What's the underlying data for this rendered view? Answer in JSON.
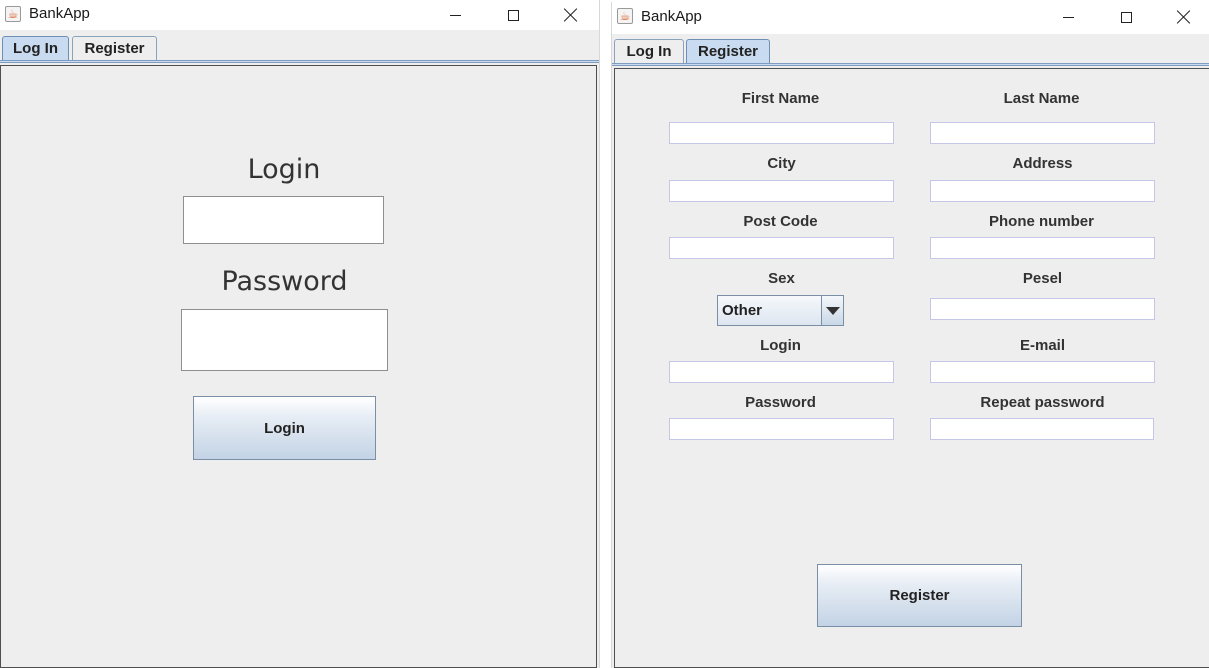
{
  "login_window": {
    "title": "BankApp",
    "tabs": [
      {
        "label": "Log In",
        "active": true
      },
      {
        "label": "Register",
        "active": false
      }
    ],
    "login_label": "Login",
    "password_label": "Password",
    "login_value": "",
    "password_value": "",
    "login_button": "Login"
  },
  "register_window": {
    "title": "BankApp",
    "tabs": [
      {
        "label": "Log In",
        "active": false
      },
      {
        "label": "Register",
        "active": true
      }
    ],
    "fields": {
      "first_name": {
        "label": "First Name",
        "value": ""
      },
      "last_name": {
        "label": "Last Name",
        "value": ""
      },
      "city": {
        "label": "City",
        "value": ""
      },
      "address": {
        "label": "Address",
        "value": ""
      },
      "post_code": {
        "label": "Post Code",
        "value": ""
      },
      "phone_number": {
        "label": "Phone number",
        "value": ""
      },
      "sex": {
        "label": "Sex",
        "value": "Other"
      },
      "pesel": {
        "label": "Pesel",
        "value": ""
      },
      "login": {
        "label": "Login",
        "value": ""
      },
      "email": {
        "label": "E-mail",
        "value": ""
      },
      "password": {
        "label": "Password",
        "value": ""
      },
      "repeat_password": {
        "label": "Repeat password",
        "value": ""
      }
    },
    "register_button": "Register"
  },
  "colors": {
    "background": "#eeeeee",
    "active_tab": "#c8dbf0",
    "button_gradient_bottom": "#c3d3e5",
    "input_border": "#c6c6e8"
  },
  "icons": [
    "java-app-icon",
    "minimize-icon",
    "maximize-icon",
    "close-icon",
    "chevron-down-icon"
  ]
}
